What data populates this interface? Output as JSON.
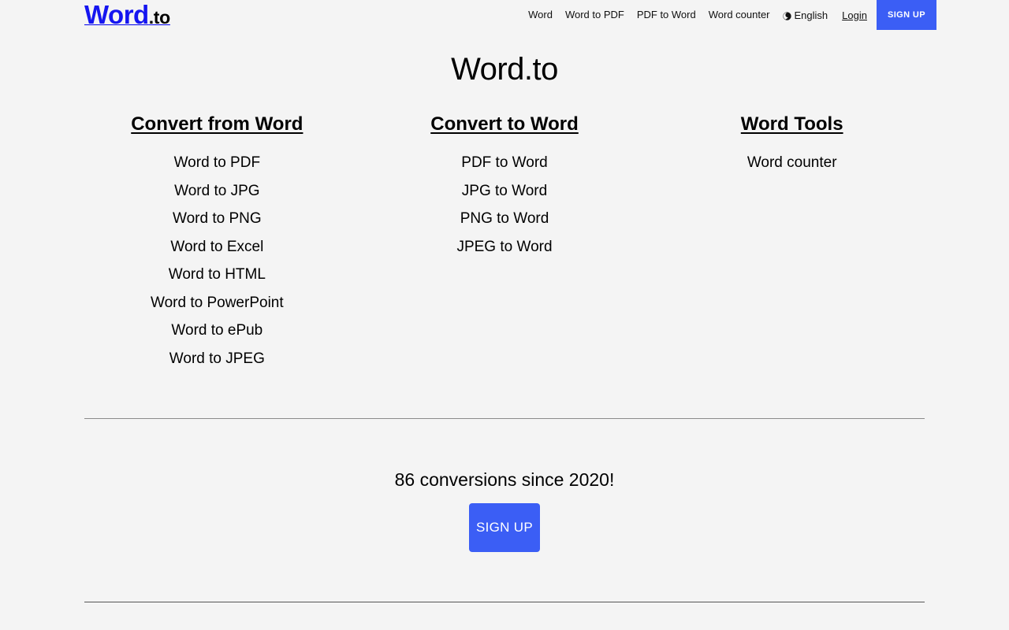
{
  "header": {
    "logo": {
      "primary": "Word",
      "suffix": ".to",
      "primary_color": "#1515f0"
    },
    "nav": [
      {
        "label": "Word"
      },
      {
        "label": "Word to PDF"
      },
      {
        "label": "PDF to Word"
      },
      {
        "label": "Word counter"
      }
    ],
    "language": {
      "icon": "globe-icon",
      "label": "English"
    },
    "login_label": "Login",
    "signup_label": "SIGN UP",
    "accent_color": "#3b5ef5"
  },
  "main": {
    "title": "Word.to",
    "columns": [
      {
        "heading": "Convert from Word",
        "links": [
          "Word to PDF",
          "Word to JPG",
          "Word to PNG",
          "Word to Excel",
          "Word to HTML",
          "Word to PowerPoint",
          "Word to ePub",
          "Word to JPEG"
        ]
      },
      {
        "heading": "Convert to Word",
        "links": [
          "PDF to Word",
          "JPG to Word",
          "PNG to Word",
          "JPEG to Word"
        ]
      },
      {
        "heading": "Word Tools",
        "links": [
          "Word counter"
        ]
      }
    ]
  },
  "cta": {
    "stat_text": "86 conversions since 2020!",
    "button_label": "SIGN UP"
  }
}
